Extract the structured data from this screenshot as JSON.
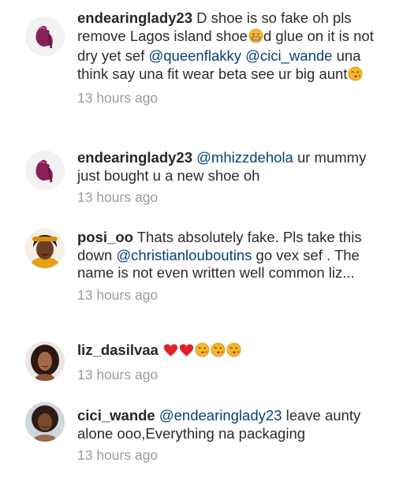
{
  "comments": [
    {
      "username": "endearinglady23",
      "avatar": "pink-heel-avatar",
      "segments": [
        {
          "t": "text",
          "v": " D shoe is so fake oh pls remove Lagos island shoe"
        },
        {
          "t": "emoji",
          "v": "grimacing-face-emoji"
        },
        {
          "t": "text",
          "v": "d glue on it is not dry yet sef "
        },
        {
          "t": "mention",
          "v": "@queenflakky"
        },
        {
          "t": "text",
          "v": " "
        },
        {
          "t": "mention",
          "v": "@cici_wande"
        },
        {
          "t": "text",
          "v": " una think say una fit wear beta see ur big aunt"
        },
        {
          "t": "emoji",
          "v": "kissing-face-emoji"
        }
      ],
      "timestamp": "13 hours ago"
    },
    {
      "username": "endearinglady23",
      "avatar": "pink-heel-avatar",
      "segments": [
        {
          "t": "text",
          "v": " "
        },
        {
          "t": "mention",
          "v": "@mhizzdehola"
        },
        {
          "t": "text",
          "v": " ur mummy just bought u a new shoe oh"
        }
      ],
      "timestamp": "13 hours ago"
    },
    {
      "username": "posi_oo",
      "avatar": "woman-orange-avatar",
      "segments": [
        {
          "t": "text",
          "v": " Thats absolutely fake. Pls take this down "
        },
        {
          "t": "mention",
          "v": "@christianlouboutins"
        },
        {
          "t": "text",
          "v": " go vex sef . The name is not even written well common liz..."
        }
      ],
      "timestamp": "13 hours ago"
    },
    {
      "username": "liz_dasilvaa",
      "avatar": "woman-curls-avatar",
      "segments": [
        {
          "t": "text",
          "v": " "
        },
        {
          "t": "emoji",
          "v": "red-heart-emoji"
        },
        {
          "t": "emoji",
          "v": "red-heart-emoji"
        },
        {
          "t": "emoji",
          "v": "kissing-face-emoji"
        },
        {
          "t": "emoji",
          "v": "kissing-face-emoji"
        },
        {
          "t": "emoji",
          "v": "kissing-face-emoji"
        }
      ],
      "timestamp": "13 hours ago"
    },
    {
      "username": "cici_wande",
      "avatar": "woman-afro-avatar",
      "segments": [
        {
          "t": "text",
          "v": " "
        },
        {
          "t": "mention",
          "v": "@endearinglady23"
        },
        {
          "t": "text",
          "v": " leave aunty alone ooo,Everything na packaging"
        }
      ],
      "timestamp": "13 hours ago"
    }
  ],
  "colors": {
    "username": "#262626",
    "text": "#2b2b2b",
    "mention": "#0a3f73",
    "timestamp": "#9a9a9a",
    "heart": "#e0212b",
    "emoji_face": "#f6b62a"
  }
}
